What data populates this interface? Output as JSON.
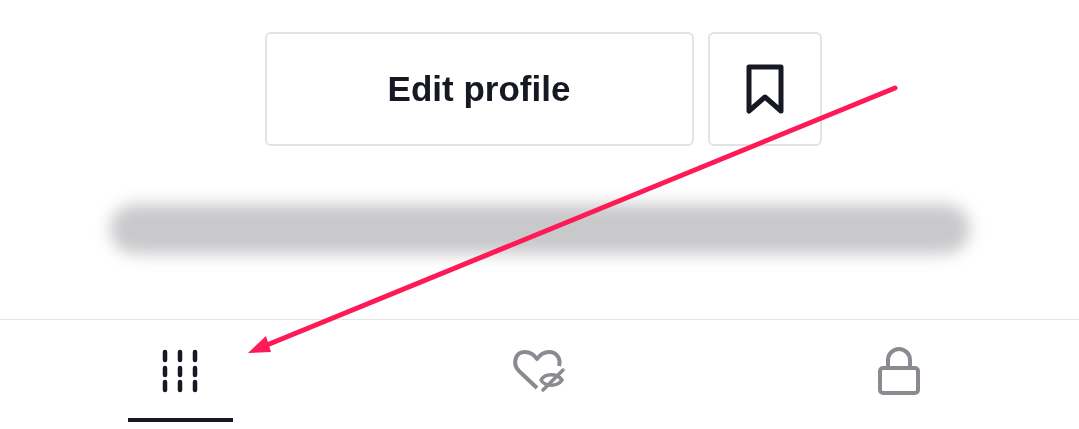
{
  "profile_actions": {
    "edit_button": {
      "label": "Edit profile"
    },
    "bookmark_button": {
      "kind": "bookmark"
    }
  },
  "tabs": [
    {
      "kind": "grid",
      "selected": true
    },
    {
      "kind": "liked-hidden",
      "selected": false
    },
    {
      "kind": "private",
      "selected": false
    }
  ]
}
